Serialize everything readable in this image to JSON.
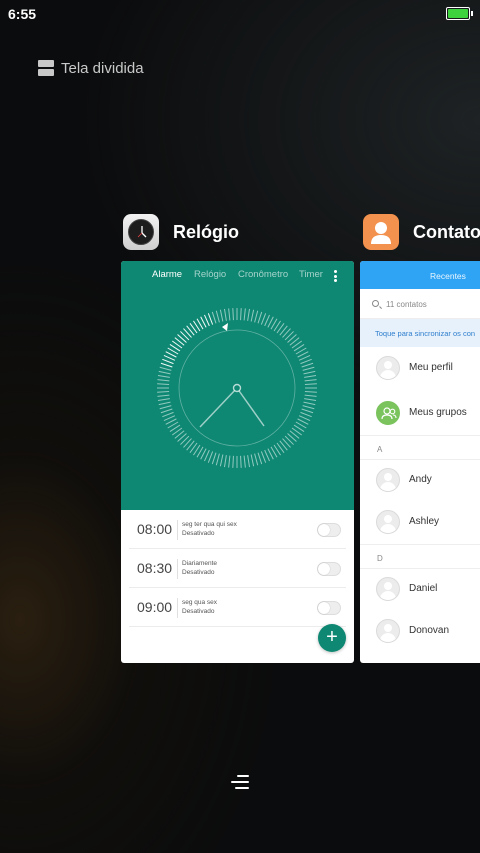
{
  "status_bar": {
    "time": "6:55",
    "battery_level": 1.0,
    "battery_color": "#3fd23f"
  },
  "split_screen": {
    "label": "Tela dividida",
    "icon": "split-screen-icon"
  },
  "clock_app": {
    "title": "Relógio",
    "icon": "clock-icon",
    "accent_color": "#0e8873",
    "tabs": [
      "Alarme",
      "Relógio",
      "Cronômetro",
      "Timer"
    ],
    "active_tab": "Alarme",
    "alarms": [
      {
        "time": "08:00",
        "days": "seg ter qua qui sex",
        "status": "Desativado",
        "enabled": false
      },
      {
        "time": "08:30",
        "days": "Diariamente",
        "status": "Desativado",
        "enabled": false
      },
      {
        "time": "09:00",
        "days": "seg qua sex",
        "status": "Desativado",
        "enabled": false
      }
    ],
    "fab": "+"
  },
  "contacts_app": {
    "title": "Contatos",
    "icon": "contacts-icon",
    "accent_color": "#2fa3f4",
    "tab": "Recentes",
    "search_placeholder": "11 contatos",
    "sync_banner": "Toque para sincronizar os con",
    "my_profile": "Meu perfil",
    "my_groups": "Meus grupos",
    "sections": [
      {
        "letter": "A",
        "contacts": [
          "Andy",
          "Ashley"
        ]
      },
      {
        "letter": "D",
        "contacts": [
          "Daniel",
          "Donovan"
        ]
      }
    ]
  }
}
